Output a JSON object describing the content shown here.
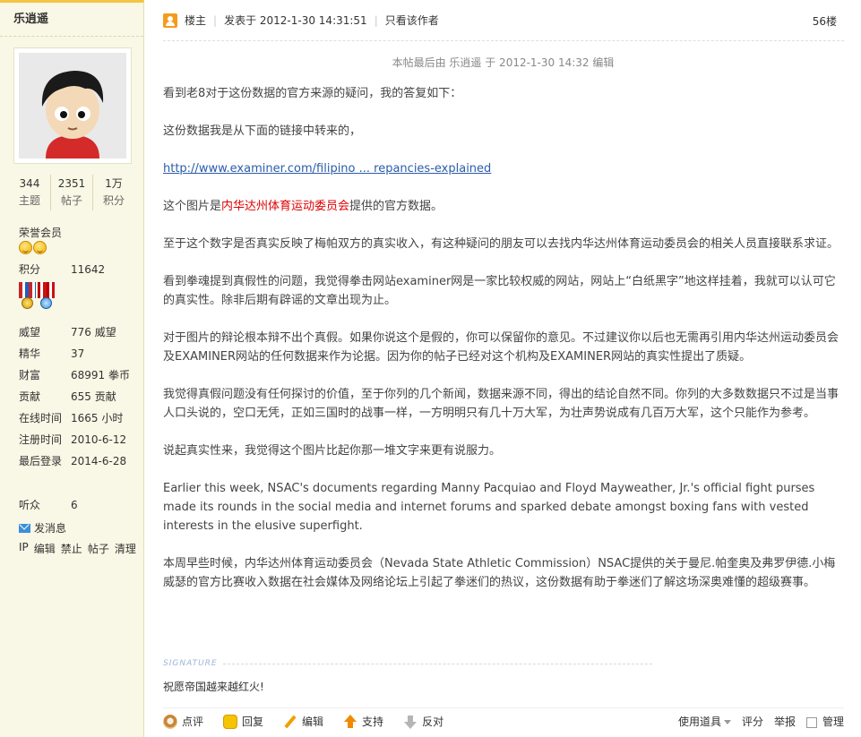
{
  "sidebar": {
    "username": "乐逍遥",
    "stats": [
      {
        "num": "344",
        "label": "主题"
      },
      {
        "num": "2351",
        "label": "帖子"
      },
      {
        "num": "1万",
        "label": "积分"
      }
    ],
    "rank": "荣誉会员",
    "points_label": "积分",
    "points_value": "11642",
    "fields": [
      {
        "k": "威望",
        "v": "776 威望"
      },
      {
        "k": "精华",
        "v": "37"
      },
      {
        "k": "财富",
        "v": "68991 拳币"
      },
      {
        "k": "贡献",
        "v": "655 贡献"
      },
      {
        "k": "在线时间",
        "v": "1665 小时"
      },
      {
        "k": "注册时间",
        "v": "2010-6-12"
      },
      {
        "k": "最后登录",
        "v": "2014-6-28"
      }
    ],
    "listeners_label": "听众",
    "listeners_value": "6",
    "send_message": "发消息",
    "admin_links": [
      "IP",
      "编辑",
      "禁止",
      "帖子",
      "清理"
    ]
  },
  "post": {
    "louzhu": "楼主",
    "posted_at": "发表于 2012-1-30 14:31:51",
    "only_author": "只看该作者",
    "floor": "56楼",
    "last_edited": "本帖最后由 乐逍遥 于 2012-1-30 14:32 编辑",
    "p1": "看到老8对于这份数据的官方来源的疑问，我的答复如下：",
    "p2": "这份数据我是从下面的链接中转来的，",
    "link": "http://www.examiner.com/filipino ... repancies-explained",
    "p4_pre": "这个图片是",
    "p4_red": "内华达州体育运动委员会",
    "p4_post": "提供的官方数据。",
    "p5": "至于这个数字是否真实反映了梅帕双方的真实收入，有这种疑问的朋友可以去找内华达州体育运动委员会的相关人员直接联系求证。",
    "p6": "看到拳魂提到真假性的问题，我觉得拳击网站examiner网是一家比较权威的网站，网站上“白纸黑字”地这样挂着，我就可以认可它的真实性。除非后期有辟谣的文章出现为止。",
    "p7": "对于图片的辩论根本辩不出个真假。如果你说这个是假的，你可以保留你的意见。不过建议你以后也无需再引用内华达州运动委员会及EXAMINER网站的任何数据来作为论据。因为你的帖子已经对这个机构及EXAMINER网站的真实性提出了质疑。",
    "p8": "我觉得真假问题没有任何探讨的价值，至于你列的几个新闻，数据来源不同，得出的结论自然不同。你列的大多数数据只不过是当事人口头说的，空口无凭，正如三国时的战事一样，一方明明只有几十万大军，为壮声势说成有几百万大军，这个只能作为参考。",
    "p9": "说起真实性来，我觉得这个图片比起你那一堆文字来更有说服力。",
    "p10": "Earlier this week, NSAC's documents regarding Manny Pacquiao and Floyd Mayweather, Jr.'s official fight purses made its rounds in the social media and internet forums and sparked debate amongst boxing fans with vested interests in the elusive superfight.",
    "p11": "本周早些时候，内华达州体育运动委员会（Nevada State Athletic Commission）NSAC提供的关于曼尼.帕奎奥及弗罗伊德.小梅威瑟的官方比赛收入数据在社会媒体及网络论坛上引起了拳迷们的热议，这份数据有助于拳迷们了解这场深奥难懂的超级赛事。",
    "signature_label": "SIGNATURE",
    "signature": "祝愿帝国越来越红火!"
  },
  "actions": {
    "comment": "点评",
    "reply": "回复",
    "edit": "编辑",
    "support": "支持",
    "oppose": "反对",
    "tools": "使用道具",
    "rate": "评分",
    "report": "举报",
    "manage": "管理"
  },
  "colors": {
    "sidebar_bg": "#f9f7e5",
    "link": "#2a5caa",
    "highlight_red": "#e00000"
  }
}
